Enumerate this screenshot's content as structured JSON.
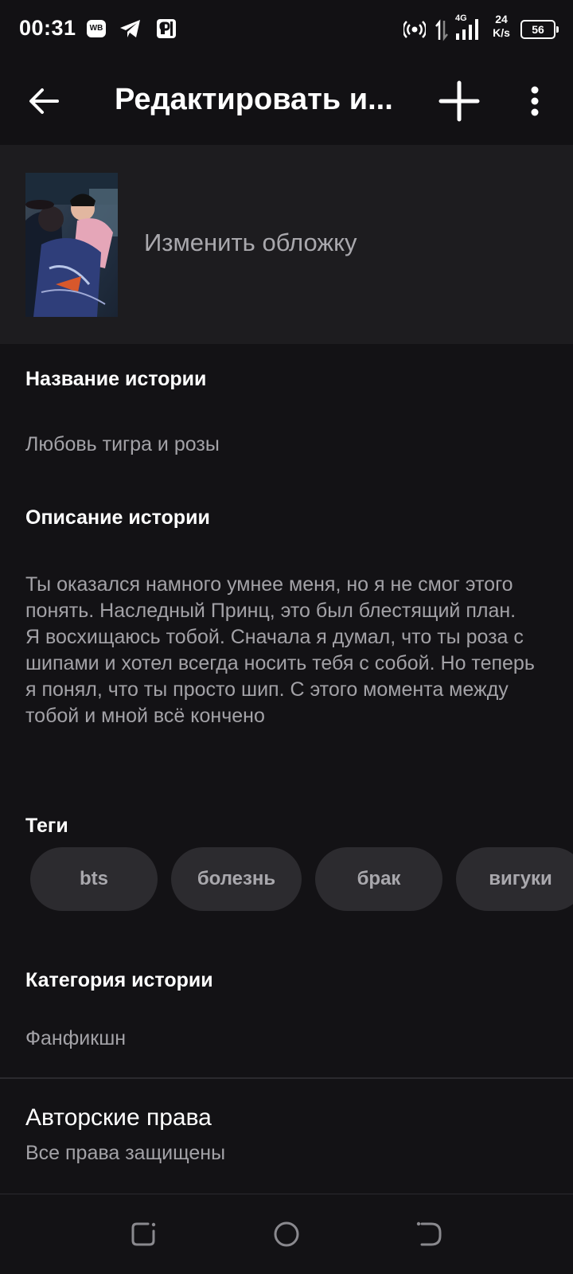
{
  "status_bar": {
    "time": "00:31",
    "wb_badge": "WB",
    "network_type": "4G",
    "speed_value": "24",
    "speed_unit": "K/s",
    "battery": "56",
    "icons": [
      "wb-app-icon",
      "telegram-icon",
      "parking-app-icon",
      "hotspot-icon",
      "data-arrows-icon",
      "signal-icon",
      "battery-icon"
    ]
  },
  "app_bar": {
    "title": "Редактировать и...",
    "icons": [
      "back-arrow-icon",
      "plus-icon",
      "more-vert-icon"
    ]
  },
  "cover": {
    "label": "Изменить обложку"
  },
  "fields": {
    "story_title_label": "Название истории",
    "story_title_value": "Любовь тигра и розы",
    "description_label": "Описание истории",
    "description_value": "Ты оказался намного умнее меня, но я не смог этого понять. Наследный Принц, это был блестящий план. Я восхищаюсь тобой. Сначала я думал, что ты роза с шипами и хотел всегда носить тебя с собой. Но теперь я понял, что ты просто шип. С этого момента между тобой и мной всё кончено",
    "tags_label": "Теги",
    "tags": [
      "bts",
      "болезнь",
      "брак",
      "вигуки"
    ],
    "category_label": "Категория истории",
    "category_value": "Фанфикшн",
    "copyright_label": "Авторские права",
    "copyright_value": "Все права защищены"
  },
  "nav_bar": {
    "icons": [
      "recents-icon",
      "home-icon",
      "back-icon"
    ]
  },
  "colors": {
    "background": "#131215",
    "cover_section": "#1d1c1f",
    "chip": "#2c2b2f",
    "secondary_text": "#a3a2a7"
  }
}
